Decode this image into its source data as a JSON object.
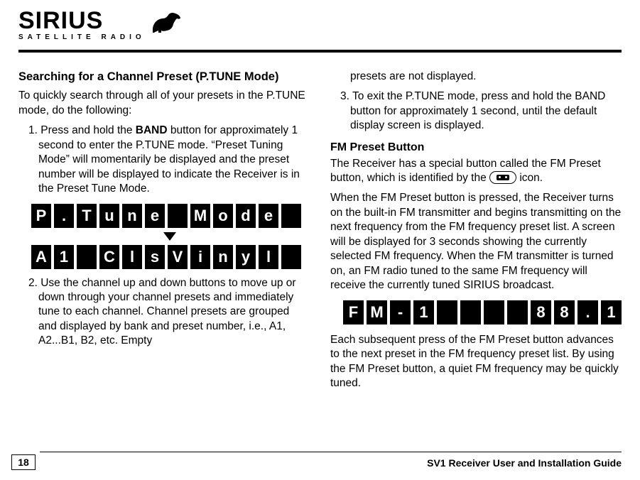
{
  "logo": {
    "brand": "SIRIUS",
    "tagline": "SATELLITE RADIO"
  },
  "left": {
    "heading": "Searching for a Channel Preset (P.TUNE Mode)",
    "intro": "To quickly search through all of your presets in the P.TUNE mode, do the following:",
    "step1_a": "1. Press and hold the ",
    "step1_band": "BAND",
    "step1_b": " button for approximately 1 second to enter the P.TUNE mode. “Preset Tuning Mode” will momentarily be displayed and the preset number will be displayed to indicate the Receiver is in the Preset Tune Mode.",
    "lcd_row1": [
      "P",
      ".",
      "T",
      "u",
      "n",
      "e",
      "",
      "M",
      "o",
      "d",
      "e",
      ""
    ],
    "lcd_row2": [
      "A",
      "1",
      "",
      "C",
      "l",
      "s",
      "V",
      "i",
      "n",
      "y",
      "l",
      ""
    ],
    "step2": "2. Use the channel up and down buttons to move up or down through your channel presets and immediately tune to each channel. Channel presets are grouped and displayed by bank and preset number, i.e.,  A1, A2...B1, B2, etc. Empty"
  },
  "right": {
    "cont1": "presets are not displayed.",
    "step3": "3. To exit the P.TUNE mode, press and hold the BAND button for approximately 1 second, until the default display screen is displayed.",
    "heading2": "FM Preset Button",
    "p1a": "The Receiver has a special button called the FM Preset button, which is identified by the ",
    "p1b": " icon.",
    "p2": "When the FM Preset button is pressed, the Receiver turns on the built-in FM transmitter and begins transmitting on the next frequency from the FM frequency preset list. A screen will be displayed for 3 seconds showing the currently selected FM frequency. When the FM transmitter is turned on, an FM radio tuned to the same FM frequency will receive the currently tuned SIRIUS broadcast.",
    "lcd_row": [
      "F",
      "M",
      "-",
      "1",
      "",
      "",
      "",
      "",
      "8",
      "8",
      ".",
      "1"
    ],
    "p3": "Each subsequent press of the FM Preset button advances to the next preset in the FM frequency preset list. By using the FM Preset button, a quiet FM frequency may be quickly tuned."
  },
  "footer": {
    "page": "18",
    "title": "SV1 Receiver User and Installation Guide"
  }
}
